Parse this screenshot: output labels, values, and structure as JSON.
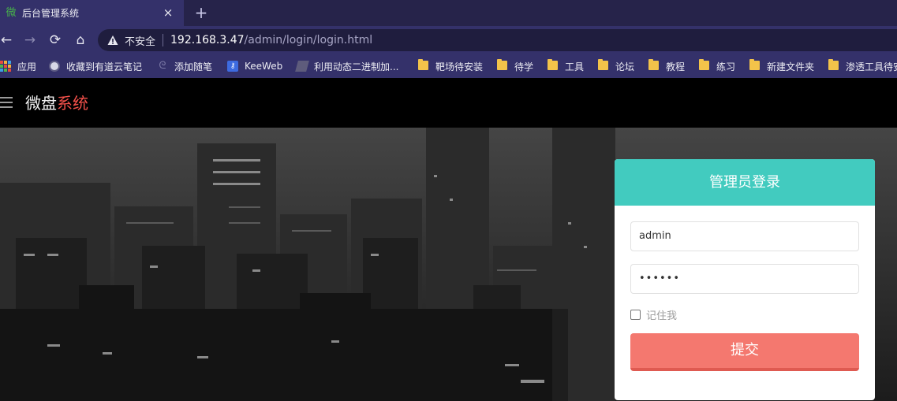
{
  "browser": {
    "tab": {
      "favicon": "微",
      "title": "后台管理系统",
      "close": "×"
    },
    "new_tab": "+",
    "nav": {
      "back": "←",
      "forward": "→",
      "reload": "⟳",
      "home": "⌂"
    },
    "address": {
      "security_label": "不安全",
      "url_host": "192.168.3.47",
      "url_path": "/admin/login/login.html"
    },
    "bookmarks": [
      {
        "label": "应用",
        "icon": "apps-icon"
      },
      {
        "label": "收藏到有道云笔记",
        "icon": "globe-icon"
      },
      {
        "label": "添加随笔",
        "icon": "spiral-icon"
      },
      {
        "label": "KeeWeb",
        "icon": "keeweb-icon"
      },
      {
        "label": "利用动态二进制加...",
        "icon": "page-icon"
      },
      {
        "label": "靶场待安装",
        "icon": "folder-icon"
      },
      {
        "label": "待学",
        "icon": "folder-icon"
      },
      {
        "label": "工具",
        "icon": "folder-icon"
      },
      {
        "label": "论坛",
        "icon": "folder-icon"
      },
      {
        "label": "教程",
        "icon": "folder-icon"
      },
      {
        "label": "练习",
        "icon": "folder-icon"
      },
      {
        "label": "新建文件夹",
        "icon": "folder-icon"
      },
      {
        "label": "渗透工具待安",
        "icon": "folder-icon"
      }
    ]
  },
  "site": {
    "brand_part1": "微盘",
    "brand_part2": "系统",
    "brand_accent_color": "#f2504a"
  },
  "login": {
    "title": "管理员登录",
    "header_color": "#42cbbf",
    "username_value": "admin",
    "password_value": "••••••",
    "remember_label": "记住我",
    "remember_checked": false,
    "submit_label": "提交",
    "submit_color": "#f4786f"
  }
}
